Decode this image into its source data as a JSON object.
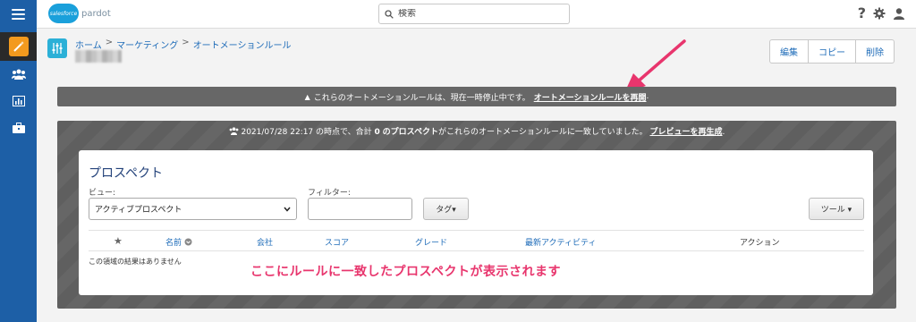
{
  "topbar": {
    "logo_cloud": "salesforce",
    "logo_text": "pardot",
    "search_placeholder": "検索",
    "icons": [
      "menu-icon",
      "help-icon",
      "gear-icon",
      "user-icon"
    ]
  },
  "sidebar": {
    "items": [
      "automation-wand-icon",
      "prospects-icon",
      "reports-icon",
      "briefcase-icon"
    ]
  },
  "breadcrumb": {
    "home": "ホーム",
    "marketing": "マーケティング",
    "automation_rules": "オートメーションルール",
    "sep": ">"
  },
  "actions": {
    "edit": "編集",
    "copy": "コピー",
    "delete": "削除"
  },
  "paused_banner": {
    "warning_icon": "▲",
    "text": "これらのオートメーションルールは、現在一時停止中です。",
    "link": "オートメーションルールを再開",
    "period": "."
  },
  "preview": {
    "icon": "users-icon",
    "text_prefix": "2021/07/28 22:17 の時点で、合計",
    "count": "0",
    "prospect_word": "のプロスペクト",
    "text_suffix": "がこれらのオートメーションルールに一致していました。",
    "link": "プレビューを再生成",
    "period": "."
  },
  "card": {
    "title": "プロスペクト",
    "view_label": "ビュー:",
    "view_value": "アクティブプロスペクト",
    "filter_label": "フィルター:",
    "tag_button": "タグ▾",
    "tool_button": "ツール ▾",
    "columns": {
      "star": "★",
      "name": "名前",
      "company": "会社",
      "score": "スコア",
      "grade": "グレード",
      "last_activity": "最新アクティビティ",
      "action": "アクション"
    },
    "empty_text": "この領域の結果はありません",
    "annotation": "ここにルールに一致したプロスペクトが表示されます"
  },
  "colors": {
    "brand_blue": "#1d5fa6",
    "link_blue": "#1d6bb8",
    "annotation_pink": "#e8356d",
    "banner_gray": "#676767"
  }
}
